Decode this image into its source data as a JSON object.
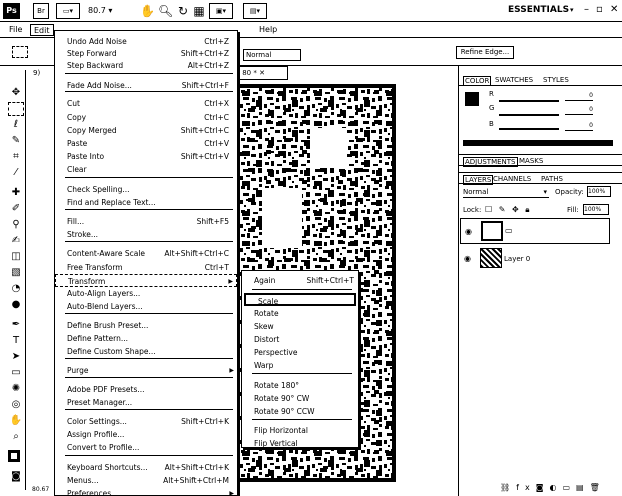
{
  "appbar": {
    "logo": "Ps",
    "btn_br": "Br",
    "zoom": "80.7",
    "workspace": "ESSENTIALS"
  },
  "menubar": {
    "items": [
      "File",
      "Edit",
      "Help"
    ]
  },
  "options": {
    "blend_mode": "Normal",
    "refine_edge": "Refine Edge..."
  },
  "document": {
    "tab_left": "9) ",
    "tab_right": "@ 80 *",
    "status_zoom": "80.67"
  },
  "edit_menu": {
    "items": [
      {
        "label": "Undo Add Noise",
        "shortcut": "Ctrl+Z"
      },
      {
        "label": "Step Forward",
        "shortcut": "Shift+Ctrl+Z"
      },
      {
        "label": "Step Backward",
        "shortcut": "Alt+Ctrl+Z"
      },
      {
        "label": "Fade Add Noise...",
        "shortcut": "Shift+Ctrl+F"
      },
      {
        "label": "Cut",
        "shortcut": "Ctrl+X"
      },
      {
        "label": "Copy",
        "shortcut": "Ctrl+C"
      },
      {
        "label": "Copy Merged",
        "shortcut": "Shift+Ctrl+C"
      },
      {
        "label": "Paste",
        "shortcut": "Ctrl+V"
      },
      {
        "label": "Paste Into",
        "shortcut": "Shift+Ctrl+V"
      },
      {
        "label": "Clear",
        "shortcut": ""
      },
      {
        "label": "Check Spelling...",
        "shortcut": ""
      },
      {
        "label": "Find and Replace Text...",
        "shortcut": ""
      },
      {
        "label": "Fill...",
        "shortcut": "Shift+F5"
      },
      {
        "label": "Stroke...",
        "shortcut": ""
      },
      {
        "label": "Content-Aware Scale",
        "shortcut": "Alt+Shift+Ctrl+C"
      },
      {
        "label": "Free Transform",
        "shortcut": "Ctrl+T"
      },
      {
        "label": "Transform",
        "shortcut": ""
      },
      {
        "label": "Auto-Align Layers...",
        "shortcut": ""
      },
      {
        "label": "Auto-Blend Layers...",
        "shortcut": ""
      },
      {
        "label": "Define Brush Preset...",
        "shortcut": ""
      },
      {
        "label": "Define Pattern...",
        "shortcut": ""
      },
      {
        "label": "Define Custom Shape...",
        "shortcut": ""
      },
      {
        "label": "Purge",
        "shortcut": ""
      },
      {
        "label": "Adobe PDF Presets...",
        "shortcut": ""
      },
      {
        "label": "Preset Manager...",
        "shortcut": ""
      },
      {
        "label": "Color Settings...",
        "shortcut": "Shift+Ctrl+K"
      },
      {
        "label": "Assign Profile...",
        "shortcut": ""
      },
      {
        "label": "Convert to Profile...",
        "shortcut": ""
      },
      {
        "label": "Keyboard Shortcuts...",
        "shortcut": "Alt+Shift+Ctrl+K"
      },
      {
        "label": "Menus...",
        "shortcut": "Alt+Shift+Ctrl+M"
      },
      {
        "label": "Preferences",
        "shortcut": ""
      }
    ]
  },
  "transform_menu": {
    "items": [
      {
        "label": "Again",
        "shortcut": "Shift+Ctrl+T"
      },
      {
        "label": "Scale",
        "shortcut": ""
      },
      {
        "label": "Rotate",
        "shortcut": ""
      },
      {
        "label": "Skew",
        "shortcut": ""
      },
      {
        "label": "Distort",
        "shortcut": ""
      },
      {
        "label": "Perspective",
        "shortcut": ""
      },
      {
        "label": "Warp",
        "shortcut": ""
      },
      {
        "label": "Rotate 180°",
        "shortcut": ""
      },
      {
        "label": "Rotate 90° CW",
        "shortcut": ""
      },
      {
        "label": "Rotate 90° CCW",
        "shortcut": ""
      },
      {
        "label": "Flip Horizontal",
        "shortcut": ""
      },
      {
        "label": "Flip Vertical",
        "shortcut": ""
      }
    ]
  },
  "panels": {
    "color_tabs": [
      "COLOR",
      "SWATCHES",
      "STYLES"
    ],
    "rgb_labels": [
      "R",
      "G",
      "B"
    ],
    "rgb_values": [
      "0",
      "0",
      "0"
    ],
    "adj_tabs": [
      "ADJUSTMENTS",
      "MASKS"
    ],
    "layer_tabs": [
      "LAYERS",
      "CHANNELS",
      "PATHS"
    ],
    "blend": "Normal",
    "opacity_label": "Opacity:",
    "opacity_value": "100%",
    "lock_label": "Lock:",
    "fill_label": "Fill:",
    "fill_value": "100%",
    "layers": [
      "",
      "Layer 0"
    ]
  }
}
